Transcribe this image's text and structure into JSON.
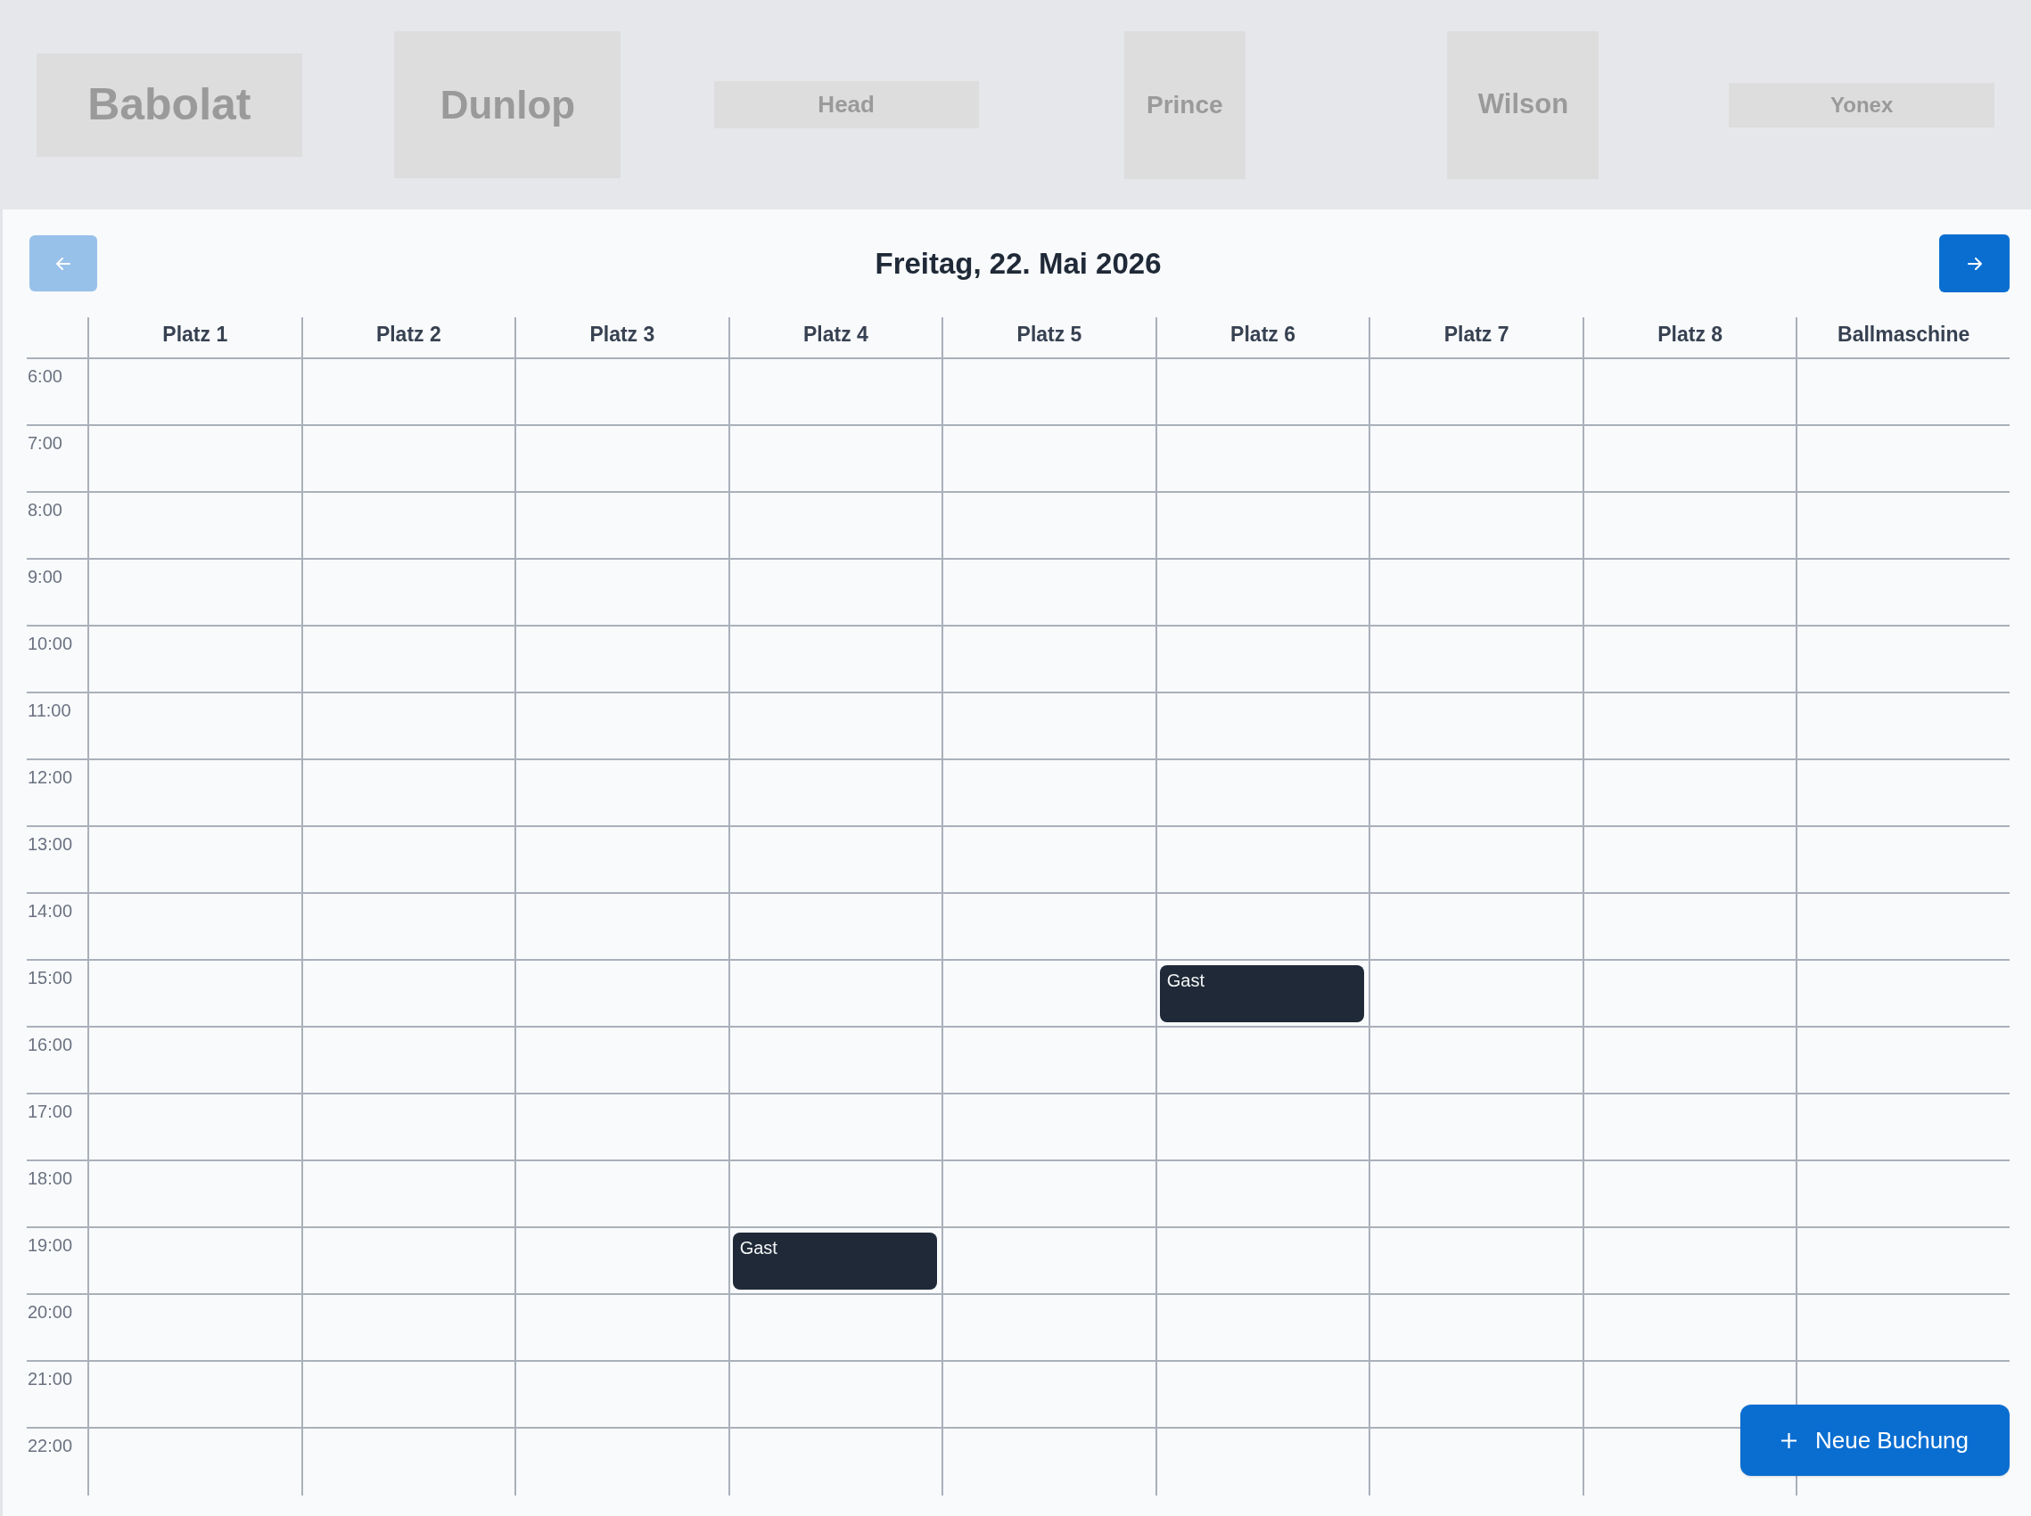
{
  "sponsors": [
    {
      "name": "Babolat"
    },
    {
      "name": "Dunlop"
    },
    {
      "name": "Head"
    },
    {
      "name": "Prince"
    },
    {
      "name": "Wilson"
    },
    {
      "name": "Yonex"
    }
  ],
  "day_nav": {
    "previous": {
      "disabled": true
    },
    "title": "Freitag, 22. Mai 2026",
    "next": {
      "disabled": false
    }
  },
  "calendar": {
    "columns": [
      "Platz 1",
      "Platz 2",
      "Platz 3",
      "Platz 4",
      "Platz 5",
      "Platz 6",
      "Platz 7",
      "Platz 8",
      "Ballmaschine"
    ],
    "rows": [
      {
        "time": "6:00",
        "cells": [
          {
            "kind": "free"
          },
          {
            "kind": "free"
          },
          {
            "kind": "free"
          },
          {
            "kind": "free"
          },
          {
            "kind": "free"
          },
          {
            "kind": "free"
          },
          {
            "kind": "free"
          },
          {
            "kind": "free"
          },
          {
            "kind": "free"
          }
        ]
      },
      {
        "time": "7:00",
        "cells": [
          {
            "kind": "free"
          },
          {
            "kind": "free"
          },
          {
            "kind": "free"
          },
          {
            "kind": "free"
          },
          {
            "kind": "free"
          },
          {
            "kind": "free"
          },
          {
            "kind": "free"
          },
          {
            "kind": "free"
          },
          {
            "kind": "free"
          }
        ]
      },
      {
        "time": "8:00",
        "cells": [
          {
            "kind": "free"
          },
          {
            "kind": "free"
          },
          {
            "kind": "free"
          },
          {
            "kind": "free"
          },
          {
            "kind": "free"
          },
          {
            "kind": "free"
          },
          {
            "kind": "free"
          },
          {
            "kind": "free"
          },
          {
            "kind": "free"
          }
        ]
      },
      {
        "time": "9:00",
        "cells": [
          {
            "kind": "free"
          },
          {
            "kind": "free"
          },
          {
            "kind": "free"
          },
          {
            "kind": "free"
          },
          {
            "kind": "free"
          },
          {
            "kind": "free"
          },
          {
            "kind": "free"
          },
          {
            "kind": "free"
          },
          {
            "kind": "free"
          }
        ]
      },
      {
        "time": "10:00",
        "cells": [
          {
            "kind": "free"
          },
          {
            "kind": "free"
          },
          {
            "kind": "free"
          },
          {
            "kind": "free"
          },
          {
            "kind": "free"
          },
          {
            "kind": "free"
          },
          {
            "kind": "free"
          },
          {
            "kind": "free"
          },
          {
            "kind": "free"
          }
        ]
      },
      {
        "time": "11:00",
        "cells": [
          {
            "kind": "free"
          },
          {
            "kind": "free"
          },
          {
            "kind": "free"
          },
          {
            "kind": "free"
          },
          {
            "kind": "free"
          },
          {
            "kind": "free"
          },
          {
            "kind": "free"
          },
          {
            "kind": "free"
          },
          {
            "kind": "free"
          }
        ]
      },
      {
        "time": "12:00",
        "cells": [
          {
            "kind": "free"
          },
          {
            "kind": "free"
          },
          {
            "kind": "free"
          },
          {
            "kind": "free"
          },
          {
            "kind": "free"
          },
          {
            "kind": "free"
          },
          {
            "kind": "free"
          },
          {
            "kind": "free"
          },
          {
            "kind": "free"
          }
        ]
      },
      {
        "time": "13:00",
        "cells": [
          {
            "kind": "free"
          },
          {
            "kind": "free"
          },
          {
            "kind": "free"
          },
          {
            "kind": "free"
          },
          {
            "kind": "free"
          },
          {
            "kind": "free"
          },
          {
            "kind": "free"
          },
          {
            "kind": "free"
          },
          {
            "kind": "free"
          }
        ]
      },
      {
        "time": "14:00",
        "cells": [
          {
            "kind": "free"
          },
          {
            "kind": "free"
          },
          {
            "kind": "free"
          },
          {
            "kind": "free"
          },
          {
            "kind": "free"
          },
          {
            "kind": "free"
          },
          {
            "kind": "free"
          },
          {
            "kind": "free"
          },
          {
            "kind": "free"
          }
        ]
      },
      {
        "time": "15:00",
        "cells": [
          {
            "kind": "free"
          },
          {
            "kind": "free"
          },
          {
            "kind": "free"
          },
          {
            "kind": "free"
          },
          {
            "kind": "free"
          },
          {
            "kind": "booked",
            "label": "Gast"
          },
          {
            "kind": "free"
          },
          {
            "kind": "free"
          },
          {
            "kind": "free"
          }
        ]
      },
      {
        "time": "16:00",
        "cells": [
          {
            "kind": "free"
          },
          {
            "kind": "free"
          },
          {
            "kind": "free"
          },
          {
            "kind": "free"
          },
          {
            "kind": "free"
          },
          {
            "kind": "free"
          },
          {
            "kind": "free"
          },
          {
            "kind": "free"
          },
          {
            "kind": "free"
          }
        ]
      },
      {
        "time": "17:00",
        "cells": [
          {
            "kind": "free"
          },
          {
            "kind": "free"
          },
          {
            "kind": "free"
          },
          {
            "kind": "free"
          },
          {
            "kind": "free"
          },
          {
            "kind": "free"
          },
          {
            "kind": "free"
          },
          {
            "kind": "free"
          },
          {
            "kind": "free"
          }
        ]
      },
      {
        "time": "18:00",
        "cells": [
          {
            "kind": "free"
          },
          {
            "kind": "free"
          },
          {
            "kind": "free"
          },
          {
            "kind": "free"
          },
          {
            "kind": "free"
          },
          {
            "kind": "free"
          },
          {
            "kind": "free"
          },
          {
            "kind": "free"
          },
          {
            "kind": "free"
          }
        ]
      },
      {
        "time": "19:00",
        "cells": [
          {
            "kind": "free"
          },
          {
            "kind": "free"
          },
          {
            "kind": "free"
          },
          {
            "kind": "booked",
            "label": "Gast"
          },
          {
            "kind": "free"
          },
          {
            "kind": "free"
          },
          {
            "kind": "free"
          },
          {
            "kind": "free"
          },
          {
            "kind": "free"
          }
        ]
      },
      {
        "time": "20:00",
        "cells": [
          {
            "kind": "free"
          },
          {
            "kind": "free"
          },
          {
            "kind": "free"
          },
          {
            "kind": "free"
          },
          {
            "kind": "free"
          },
          {
            "kind": "free"
          },
          {
            "kind": "free"
          },
          {
            "kind": "free"
          },
          {
            "kind": "free"
          }
        ]
      },
      {
        "time": "21:00",
        "cells": [
          {
            "kind": "free"
          },
          {
            "kind": "free"
          },
          {
            "kind": "free"
          },
          {
            "kind": "free"
          },
          {
            "kind": "free"
          },
          {
            "kind": "free"
          },
          {
            "kind": "free"
          },
          {
            "kind": "free"
          },
          {
            "kind": "free"
          }
        ]
      },
      {
        "time": "22:00",
        "cells": [
          {
            "kind": "free"
          },
          {
            "kind": "free"
          },
          {
            "kind": "free"
          },
          {
            "kind": "free"
          },
          {
            "kind": "free"
          },
          {
            "kind": "free"
          },
          {
            "kind": "free"
          },
          {
            "kind": "free"
          },
          {
            "kind": "free"
          }
        ]
      }
    ]
  },
  "new_booking_button": {
    "label": "Neue Buchung"
  }
}
